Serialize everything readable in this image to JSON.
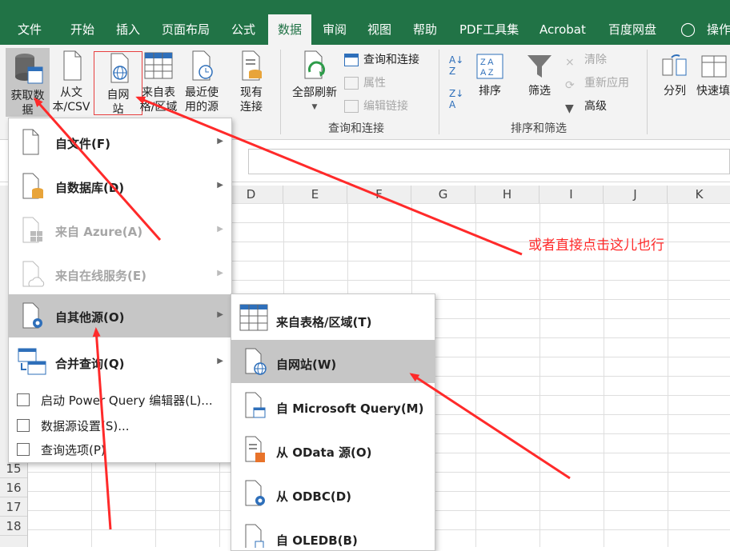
{
  "ribbon_tabs": {
    "file": "文件",
    "home": "开始",
    "insert": "插入",
    "layout": "页面布局",
    "formulas": "公式",
    "data": "数据",
    "review": "审阅",
    "view": "视图",
    "help": "帮助",
    "pdf": "PDF工具集",
    "acrobat": "Acrobat",
    "baidu": "百度网盘",
    "tell": "操作"
  },
  "ribbon": {
    "get_data": "获取数据",
    "from_text_csv": "从文本/CSV",
    "from_web": "自网站",
    "from_table": "来自表格/区域",
    "recent_sources": "最近使用的源",
    "existing_connections": "现有连接",
    "refresh_all": "全部刷新",
    "queries_connections": "查询和连接",
    "properties": "属性",
    "edit_links": "编辑链接",
    "group_queries": "查询和连接",
    "sort": "排序",
    "filter": "筛选",
    "clear": "清除",
    "reapply": "重新应用",
    "advanced": "高级",
    "group_sort_filter": "排序和筛选",
    "text_to_columns": "分列",
    "flash_fill": "快速填"
  },
  "columns": [
    "D",
    "E",
    "F",
    "G",
    "H",
    "I",
    "J",
    "K"
  ],
  "rows": [
    "15",
    "16",
    "17",
    "18"
  ],
  "get_data_menu": {
    "from_file": "自文件(F)",
    "from_database": "自数据库(D)",
    "from_azure": "来自 Azure(A)",
    "from_online": "来自在线服务(E)",
    "from_other": "自其他源(O)",
    "combine": "合并查询(Q)",
    "launch_pq": "启动 Power Query 编辑器(L)...",
    "source_settings": "数据源设置(S)...",
    "query_options": "查询选项(P)"
  },
  "other_sources_menu": {
    "from_table": "来自表格/区域(T)",
    "from_web": "自网站(W)",
    "from_msquery": "自 Microsoft Query(M)",
    "from_odata": "从 OData 源(O)",
    "from_odbc": "从 ODBC(D)",
    "from_oledb": "自 OLEDB(B)"
  },
  "annotation": "或者直接点击这儿也行",
  "colors": {
    "excel_green": "#217346",
    "highlight": "#c6c6c6",
    "annotation_red": "#ff2a2a"
  }
}
